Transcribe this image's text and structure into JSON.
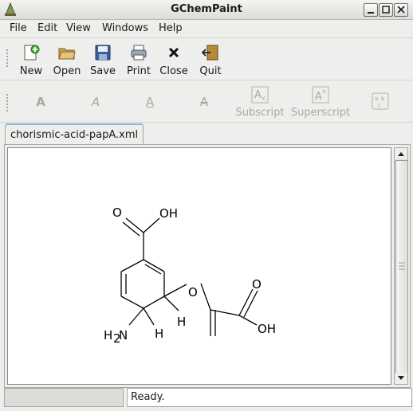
{
  "window": {
    "title": "GChemPaint"
  },
  "menu": {
    "items": [
      "File",
      "Edit",
      "View",
      "Windows",
      "Help"
    ]
  },
  "toolbar": {
    "new_label": "New",
    "open_label": "Open",
    "save_label": "Save",
    "print_label": "Print",
    "close_label": "Close",
    "quit_label": "Quit"
  },
  "format_toolbar": {
    "bold_glyph": "A",
    "italic_glyph": "A",
    "underline_glyph": "A",
    "strike_glyph": "A",
    "subscript_label": "Subscript",
    "superscript_label": "Superscript"
  },
  "tabs": [
    {
      "label": "chorismic-acid-papA.xml"
    }
  ],
  "molecule": {
    "labels": {
      "o_top": "O",
      "oh_top": "OH",
      "ether_o": "O",
      "o_right": "O",
      "oh_right": "OH",
      "h_ring": "H",
      "h_amine_side": "H",
      "nh2_h": "H",
      "nh2_sub": "2",
      "nh2_n": "N"
    }
  },
  "status": {
    "text": "Ready."
  },
  "colors": {
    "tab_highlight": "#8cb1d9",
    "canvas_bg": "#ffffff",
    "window_bg": "#eeeeec"
  }
}
